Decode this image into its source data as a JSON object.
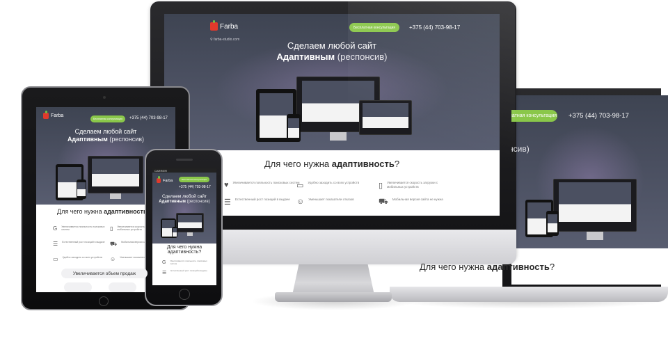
{
  "site": {
    "logo": "Farba",
    "url": "farba-studio.com",
    "consult_button": "Бесплатная консультация",
    "phone": "+375 (44) 703-98-17",
    "hero_line1": "Сделаем любой сайт",
    "hero_bold": "Адаптивным",
    "hero_thin": "(респонсив)",
    "section_title_pre": "Для чего нужна",
    "section_title_bold": "адаптивность",
    "section_title_post": "?",
    "mini_section": "Для чего нужна адаптивность",
    "features": [
      {
        "icon": "heart-icon",
        "text": "Увеличивается лояльность поисковых систем"
      },
      {
        "icon": "devices-icon",
        "text": "Удобно заходить со всех устройств"
      },
      {
        "icon": "phone-icon",
        "text": "Увеличивается скорость загрузки с мобильных устройств"
      },
      {
        "icon": "list-icon",
        "text": "Естественный рост позиций в выдаче"
      },
      {
        "icon": "smile-icon",
        "text": "Уменьшает показатели отказов"
      },
      {
        "icon": "truck-icon",
        "text": "Мобильная версия сайта не нужна"
      }
    ],
    "sales_pill": "Увеличивается объем продаж",
    "iphone_section_line1": "Для чего нужна",
    "iphone_section_line2": "адаптивность?",
    "iphone_carrier": "CARRIER"
  },
  "colors": {
    "accent": "#8ac74a",
    "logo_red": "#e03a2c",
    "hero_dark": "#3e4452"
  }
}
